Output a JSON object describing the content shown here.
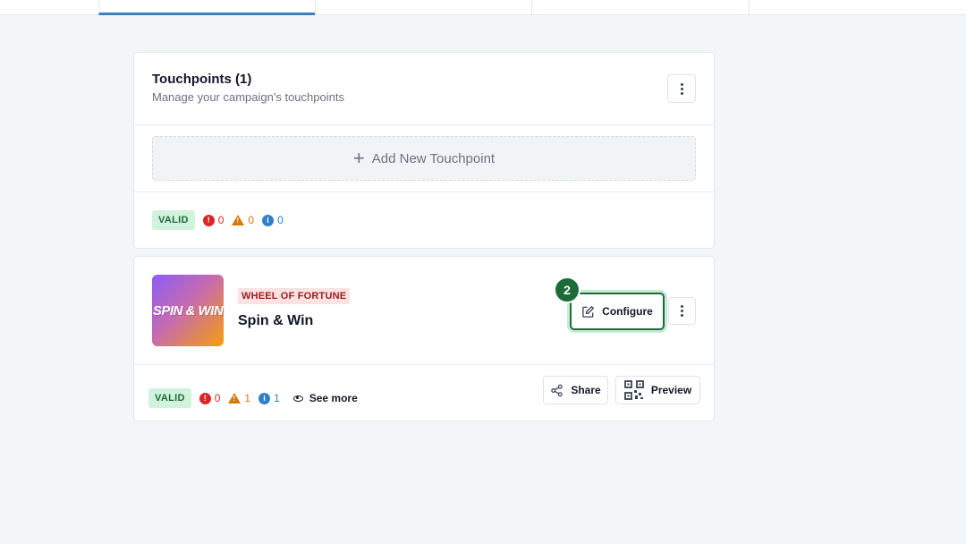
{
  "tabs": [
    {
      "label": "",
      "active": true
    },
    {
      "label": "",
      "active": false
    },
    {
      "label": "",
      "active": false
    },
    {
      "label": "",
      "active": false
    }
  ],
  "touchpoints_card": {
    "title": "Touchpoints (1)",
    "subtitle": "Manage your campaign's touchpoints",
    "menu_icon": "kebab-menu-icon",
    "add_label": "Add New Touchpoint",
    "status": {
      "badge": "VALID",
      "errors": "0",
      "warnings": "0",
      "infos": "0"
    }
  },
  "touchpoint": {
    "thumbnail_text": "SPIN & WIN",
    "type": "WHEEL OF FORTUNE",
    "name": "Spin & Win",
    "step_number": "2",
    "configure_label": "Configure",
    "status": {
      "badge": "VALID",
      "errors": "0",
      "warnings": "1",
      "infos": "1",
      "see_more": "See more"
    },
    "share_label": "Share",
    "preview_label": "Preview"
  },
  "colors": {
    "accent_tab": "#3b82c4",
    "valid_bg": "#d1f2dc",
    "valid_text": "#1e6b3a",
    "error": "#dc2626",
    "warning": "#d97706",
    "info": "#2f7fc9",
    "step_badge": "#1e6b3a",
    "type_badge_bg": "#fde2e2",
    "type_badge_text": "#9b1c1c"
  }
}
